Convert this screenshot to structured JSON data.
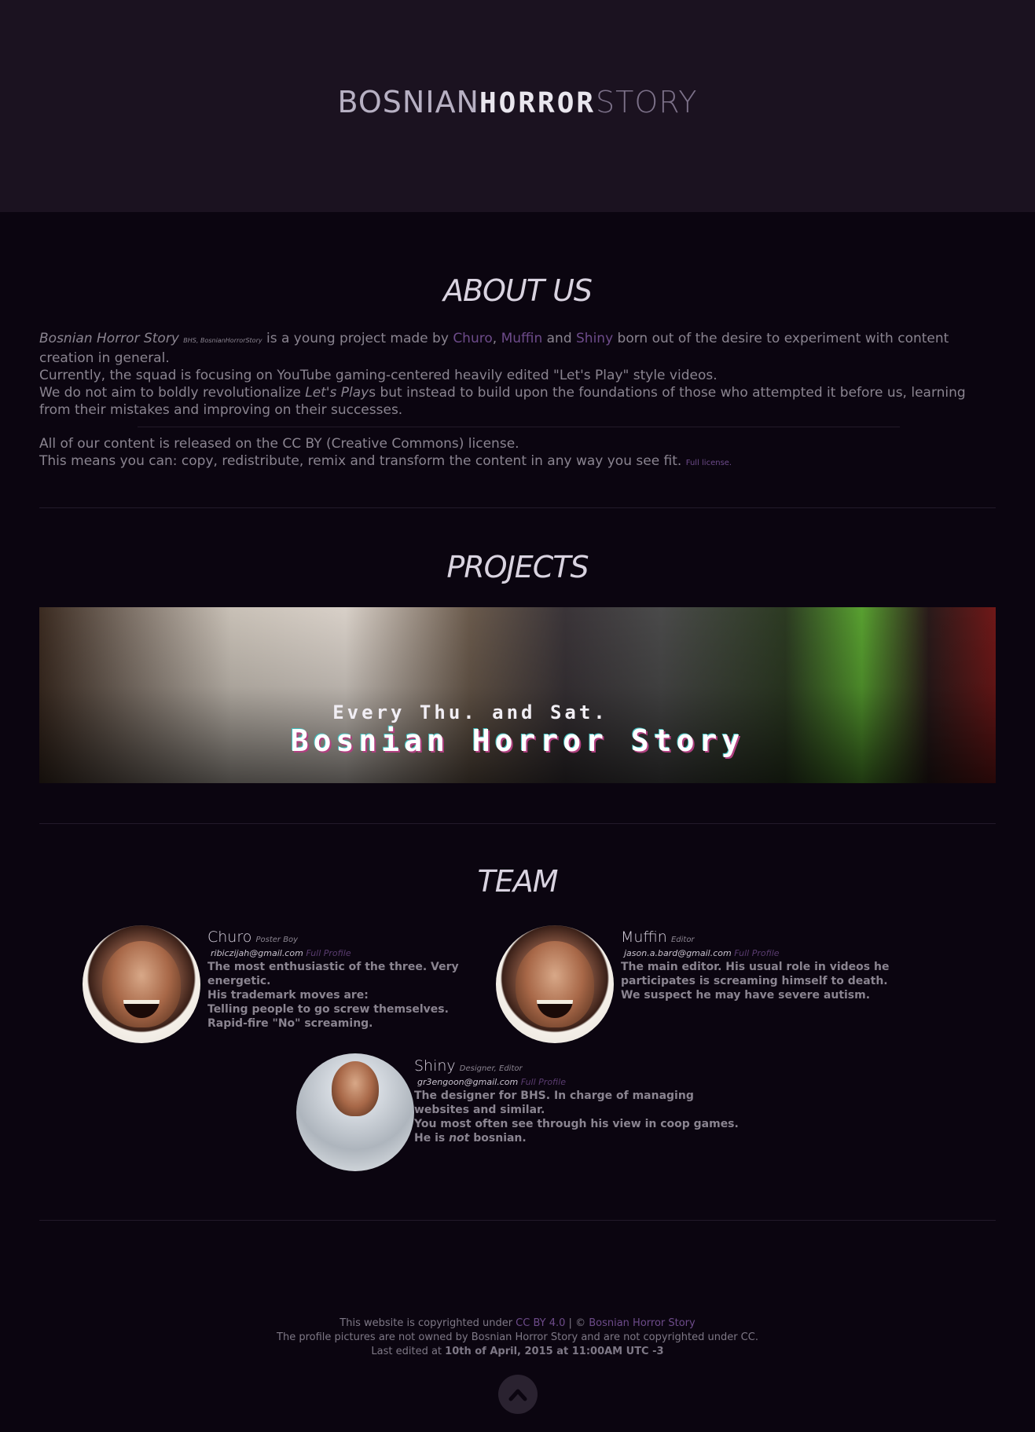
{
  "header": {
    "logo_part1": "BOSNIAN",
    "logo_part2": "HORROR",
    "logo_part3": "STORY"
  },
  "about": {
    "title": "ABOUT US",
    "brand": "Bosnian Horror Story",
    "brand_aliases": "BHS, BosnianHorrorStory",
    "intro_a": " is a young project made by ",
    "member1": "Churo",
    "sep1": ", ",
    "member2": "Muffin",
    "and": " and ",
    "member3": "Shiny",
    "intro_b": " born out of the desire to experiment with content creation in general.",
    "line2": "Currently, the squad is focusing on YouTube gaming-centered heavily edited \"Let's Play\" style videos.",
    "line3_a": "We do not aim to boldly revolutionalize ",
    "line3_em": "Let's Play",
    "line3_b": "s but instead to build upon the foundations of those who attempted it before us, learning from their mistakes and improving on their successes.",
    "license_line1": "All of our content is released on the CC BY (Creative Commons) license.",
    "license_line2": "This means you can: copy, redistribute, remix and transform the content in any way you see fit.",
    "license_link": "Full license."
  },
  "projects": {
    "title": "PROJECTS",
    "banner_line1": "Every Thu. and Sat.",
    "banner_line2": "Bosnian Horror Story"
  },
  "team": {
    "title": "TEAM",
    "profile_link": "Full Profile",
    "members": [
      {
        "name": "Churo",
        "role": "Poster Boy",
        "email": "ribiczijah@gmail.com",
        "desc": [
          "The most enthusiastic of the three. Very energetic.",
          "His trademark moves are:",
          "Telling people to go screw themselves.",
          "Rapid-fire \"No\" screaming."
        ]
      },
      {
        "name": "Muffin",
        "role": "Editor",
        "email": "jason.a.bard@gmail.com",
        "desc": [
          "The main editor. His usual role in videos he participates is screaming himself to death.",
          "We suspect he may have severe autism."
        ]
      },
      {
        "name": "Shiny",
        "role": "Designer, Editor",
        "email": "gr3engoon@gmail.com",
        "desc": [
          "The designer for BHS. In charge of managing websites and similar.",
          "You most often see through his view in coop games.",
          "He is ",
          "not",
          " bosnian."
        ]
      }
    ]
  },
  "footer": {
    "line1_a": "This website is copyrighted under ",
    "line1_link1": "CC BY 4.0",
    "line1_sep": " | © ",
    "line1_link2": "Bosnian Horror Story",
    "line2": "The profile pictures are not owned by Bosnian Horror Story and are not copyrighted under CC.",
    "line3_a": "Last edited at ",
    "line3_b": "10th of April, 2015 at 11:00AM UTC -3"
  },
  "icons": {
    "scroll_top": "chevron-up-icon"
  },
  "colors": {
    "background": "#0b0510",
    "header": "#1b1220",
    "accent": "#6d4b8a"
  }
}
